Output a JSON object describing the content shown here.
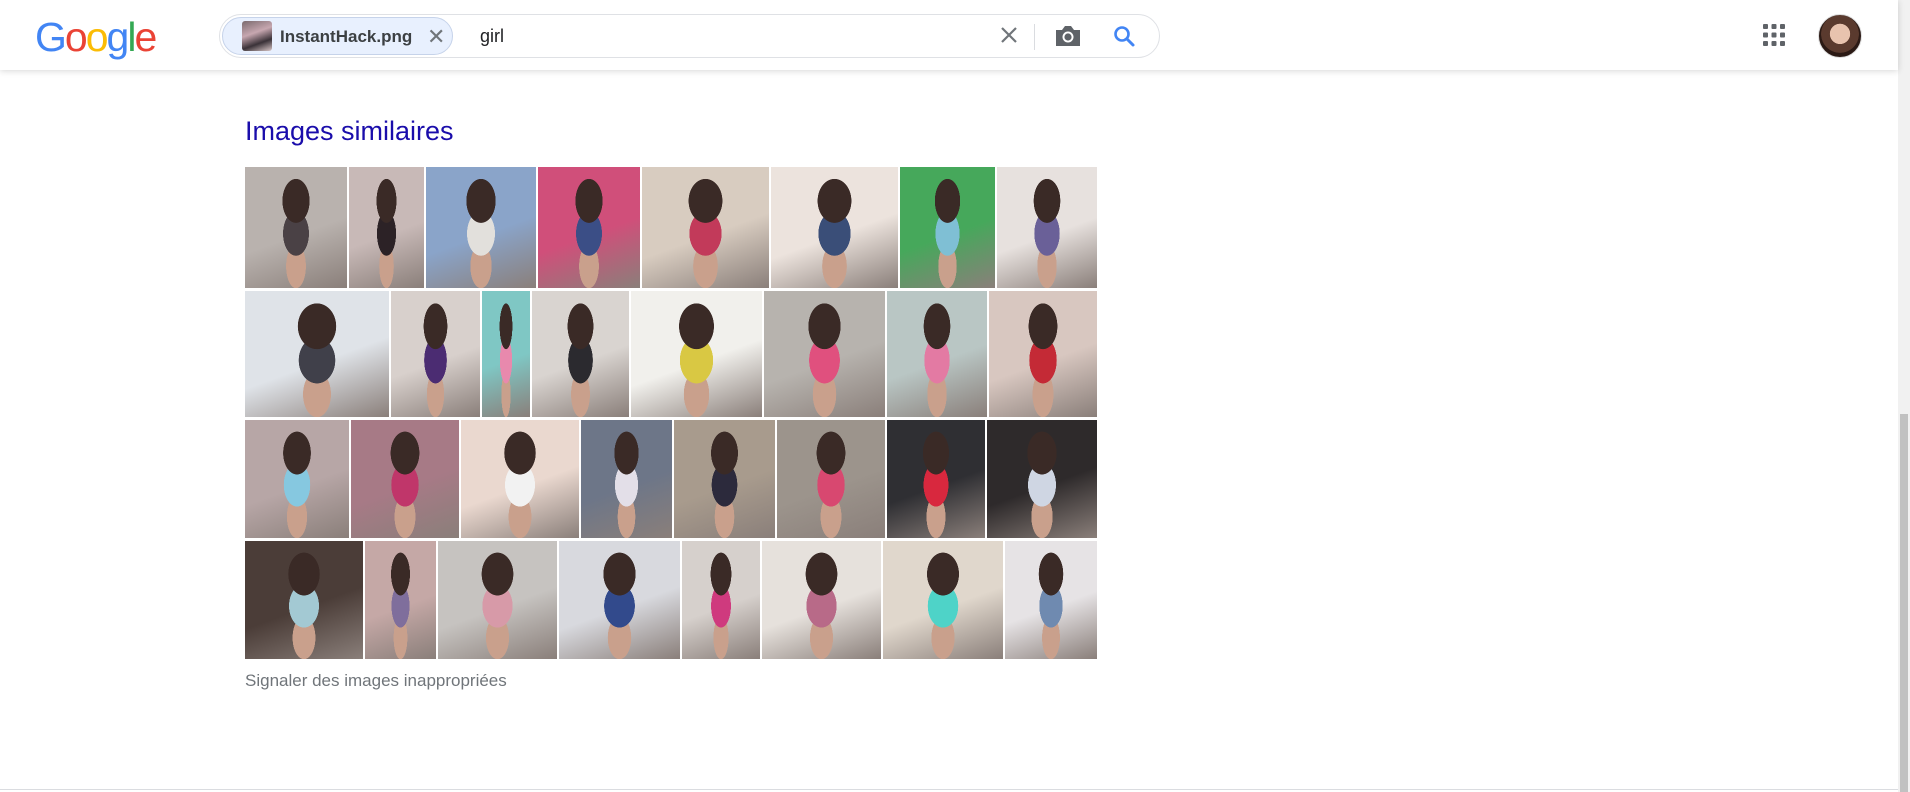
{
  "header": {
    "logo_letters": [
      {
        "char": "G",
        "color": "#4285F4"
      },
      {
        "char": "o",
        "color": "#EA4335"
      },
      {
        "char": "o",
        "color": "#FBBC05"
      },
      {
        "char": "g",
        "color": "#4285F4"
      },
      {
        "char": "l",
        "color": "#34A853"
      },
      {
        "char": "e",
        "color": "#EA4335"
      }
    ],
    "image_chip_label": "InstantHack.png",
    "query_value": "girl",
    "icons": {
      "chip_close": "close-icon",
      "clear": "close-icon",
      "camera": "camera-icon",
      "search": "search-icon",
      "apps": "apps-grid-icon",
      "account": "account-avatar"
    }
  },
  "similar": {
    "title": "Images similaires",
    "rows": [
      [
        {
          "c1": "#b9b2ae",
          "c2": "#4a4145"
        },
        {
          "c1": "#c8b9b7",
          "c2": "#2c2226"
        },
        {
          "c1": "#8aa4c9",
          "c2": "#e2e0dc"
        },
        {
          "c1": "#d04f7a",
          "c2": "#3b4e86"
        },
        {
          "c1": "#d8ccc0",
          "c2": "#c23a5a"
        },
        {
          "c1": "#ece3dd",
          "c2": "#3a4e78"
        },
        {
          "c1": "#46a85b",
          "c2": "#7fbfd4"
        },
        {
          "c1": "#e7e1de",
          "c2": "#6a6098"
        }
      ],
      [
        {
          "c1": "#dfe3e8",
          "c2": "#40404a"
        },
        {
          "c1": "#d8d0cc",
          "c2": "#4b2c72"
        },
        {
          "c1": "#7fc7c4",
          "c2": "#e889ad"
        },
        {
          "c1": "#d9d4d0",
          "c2": "#2b2a2f"
        },
        {
          "c1": "#f1f0ec",
          "c2": "#d9c843"
        },
        {
          "c1": "#b7b3ae",
          "c2": "#e0507e"
        },
        {
          "c1": "#b9c6c4",
          "c2": "#e37aa3"
        },
        {
          "c1": "#d8c7c0",
          "c2": "#c42a36"
        }
      ],
      [
        {
          "c1": "#b7a6a6",
          "c2": "#86c8e0"
        },
        {
          "c1": "#a77a86",
          "c2": "#c0366a"
        },
        {
          "c1": "#ead8cf",
          "c2": "#f2f2f2"
        },
        {
          "c1": "#6d7688",
          "c2": "#e3dfe8"
        },
        {
          "c1": "#a89b8d",
          "c2": "#2c2a3c"
        },
        {
          "c1": "#9c948c",
          "c2": "#d84870"
        },
        {
          "c1": "#2f2f33",
          "c2": "#d8283e"
        },
        {
          "c1": "#2e2a2b",
          "c2": "#cfd6e3"
        }
      ],
      [
        {
          "c1": "#4b3d38",
          "c2": "#a3c9d3"
        },
        {
          "c1": "#c5a8a6",
          "c2": "#7f6e9c"
        },
        {
          "c1": "#c6c3c0",
          "c2": "#d79aa8"
        },
        {
          "c1": "#d8d9de",
          "c2": "#324a8c"
        },
        {
          "c1": "#d6d0cc",
          "c2": "#cf3a7e"
        },
        {
          "c1": "#e6e1dc",
          "c2": "#b86a88"
        },
        {
          "c1": "#e0d7cc",
          "c2": "#4ed3c8"
        },
        {
          "c1": "#e6e3e5",
          "c2": "#6f8ab0"
        }
      ]
    ]
  },
  "report_link": "Signaler des images inappropriées"
}
